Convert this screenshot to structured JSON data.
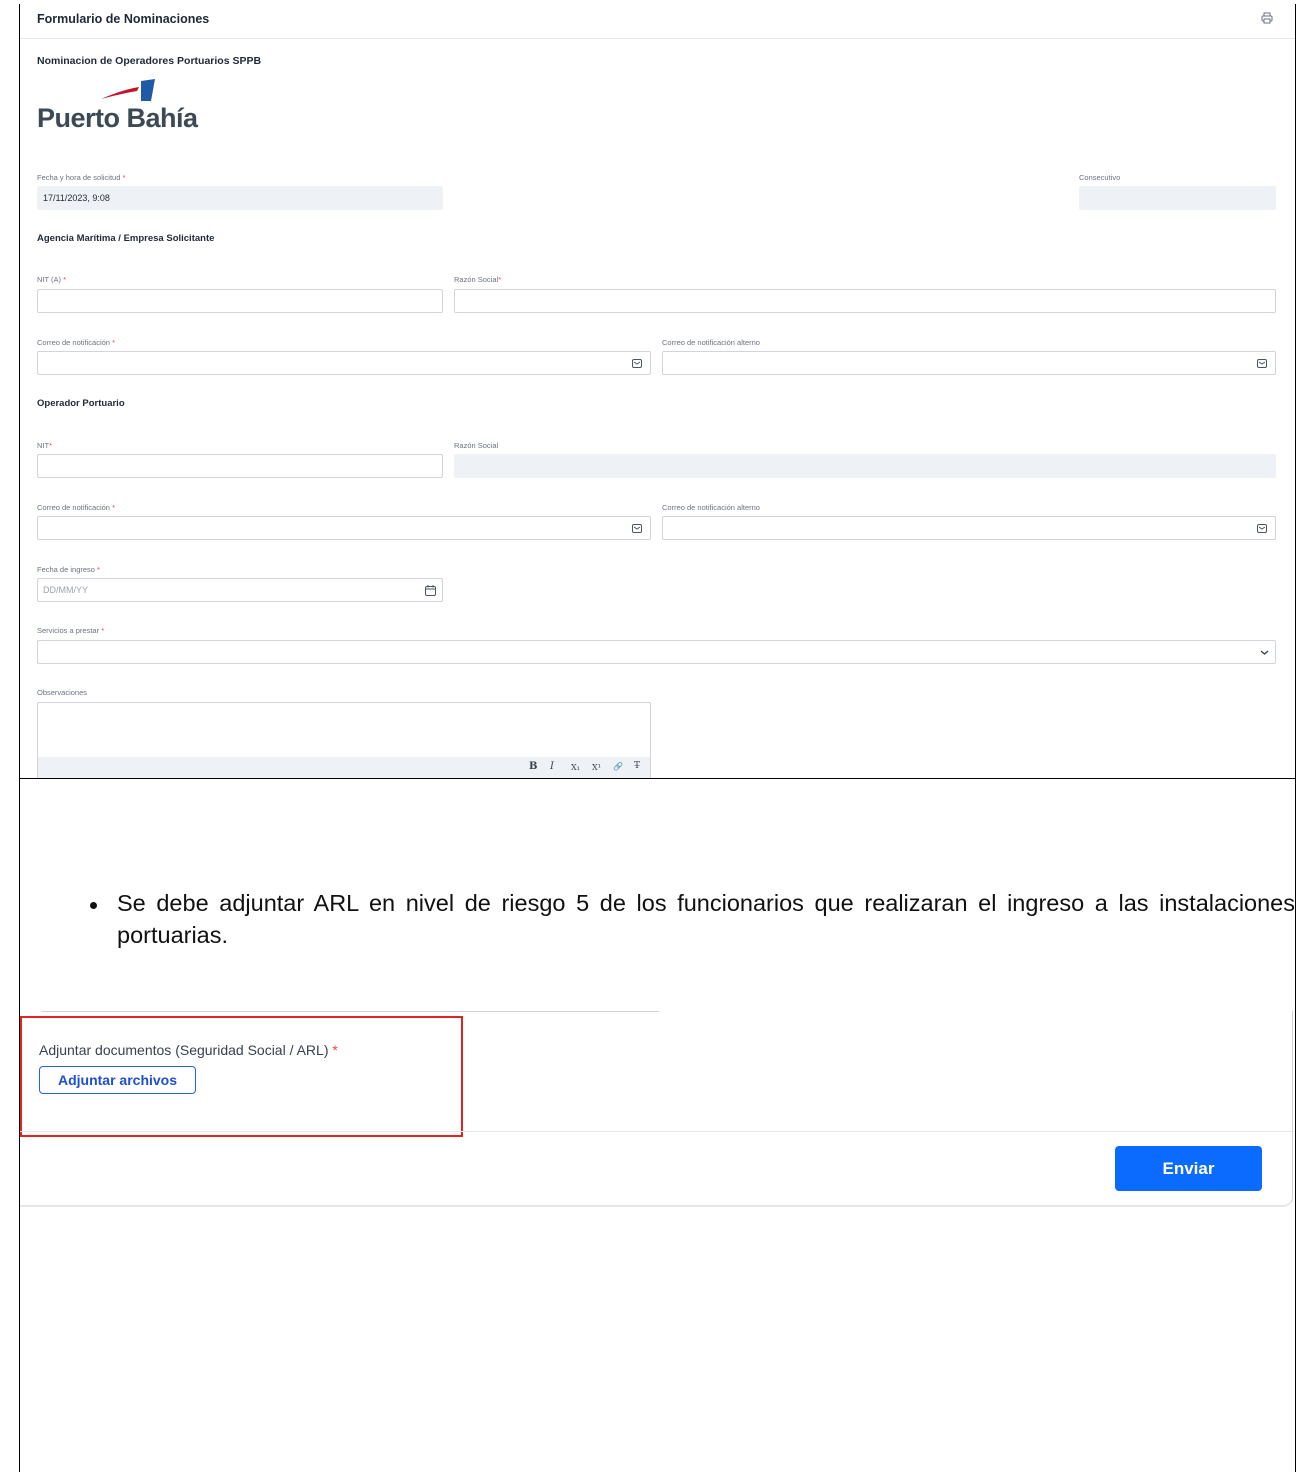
{
  "form": {
    "title": "Formulario de Nominaciones",
    "subtitle": "Nominacion de Operadores Portuarios SPPB",
    "logo_text": "Puerto Bahía",
    "fecha_label": "Fecha y hora de solicitud",
    "fecha_value": "17/11/2023, 9:08",
    "consecutivo_label": "Consecutivo",
    "agencia_section": "Agencia Marítima / Empresa Solicitante",
    "nit_a_label": "NIT (A)",
    "razon_social_req_label": "Razón Social",
    "correo_label": "Correo de notificación",
    "correo_alt_label": "Correo de notificación alterno",
    "operador_section": "Operador Portuario",
    "nit_label": "NIT",
    "razon_social_label": "Razón Social",
    "fecha_ingreso_label": "Fecha de ingreso",
    "fecha_ingreso_placeholder": "DD/MM/YY",
    "servicios_label": "Servicios a prestar",
    "observaciones_label": "Observaciones",
    "required_mark": "*",
    "toolbar": {
      "bold": "B",
      "italic": "I",
      "subscript": "X₁",
      "superscript": "X¹",
      "link": "🔗",
      "clear": "T̶"
    }
  },
  "bullet": {
    "text": "Se debe adjuntar ARL en nivel de riesgo 5 de los funcionarios que realizaran el ingreso a las instalaciones portuarias."
  },
  "attach": {
    "label": "Adjuntar documentos (Seguridad Social / ARL)",
    "required_mark": "*",
    "button": "Adjuntar archivos",
    "submit": "Enviar"
  },
  "colors": {
    "accent": "#0b6bff",
    "highlight_border": "#e02424",
    "required": "#ef4444",
    "readonly_bg": "#eef1f5",
    "logo_red": "#c8102e",
    "logo_blue": "#1e5aa8"
  }
}
